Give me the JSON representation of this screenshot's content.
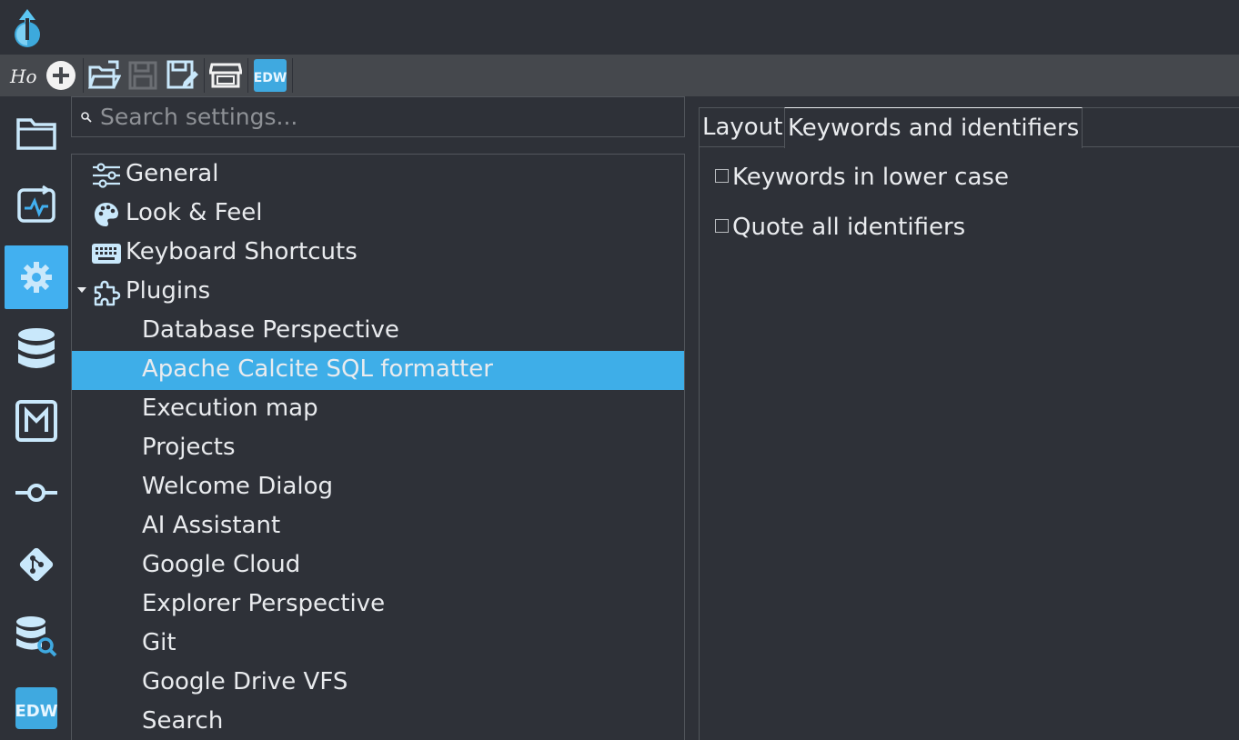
{
  "toolbar": {
    "items": [
      "hop-logo-icon",
      "new-file-icon",
      "open-folder-icon",
      "save-icon",
      "save-as-icon",
      "marketplace-icon",
      "edw-icon"
    ],
    "edw_label": "EDW"
  },
  "perspectives": {
    "items": [
      "explorer",
      "execution-monitor",
      "configuration",
      "metadata",
      "mdl",
      "pipeline",
      "git",
      "search-database",
      "edw"
    ],
    "active": "configuration",
    "edw_label": "EDW"
  },
  "search": {
    "placeholder": "Search settings..."
  },
  "tree": {
    "items": [
      {
        "label": "General",
        "icon": "sliders-icon",
        "level": 0
      },
      {
        "label": "Look & Feel",
        "icon": "palette-icon",
        "level": 0
      },
      {
        "label": "Keyboard Shortcuts",
        "icon": "keyboard-icon",
        "level": 0
      },
      {
        "label": "Plugins",
        "icon": "puzzle-icon",
        "level": 0,
        "expanded": true
      },
      {
        "label": "Database Perspective",
        "level": 1
      },
      {
        "label": "Apache Calcite SQL formatter",
        "level": 1,
        "selected": true
      },
      {
        "label": "Execution map",
        "level": 1
      },
      {
        "label": "Projects",
        "level": 1
      },
      {
        "label": "Welcome Dialog",
        "level": 1
      },
      {
        "label": "AI Assistant",
        "level": 1
      },
      {
        "label": "Google Cloud",
        "level": 1
      },
      {
        "label": "Explorer Perspective",
        "level": 1
      },
      {
        "label": "Git",
        "level": 1
      },
      {
        "label": "Google Drive VFS",
        "level": 1
      },
      {
        "label": "Search",
        "level": 1
      }
    ]
  },
  "tabs": {
    "layout_label": "Layout",
    "keywords_label": "Keywords and identifiers",
    "active": "Keywords and identifiers"
  },
  "options": {
    "keywords_lower_case": {
      "label": "Keywords in lower case",
      "checked": false
    },
    "quote_identifiers": {
      "label": "Quote all identifiers",
      "checked": false
    }
  },
  "colors": {
    "background": "#2e3138",
    "toolbar": "#45484d",
    "accent": "#42b0f0",
    "selection": "#3eaee8",
    "text": "#e9ebee",
    "icon": "#c9e8fb"
  }
}
